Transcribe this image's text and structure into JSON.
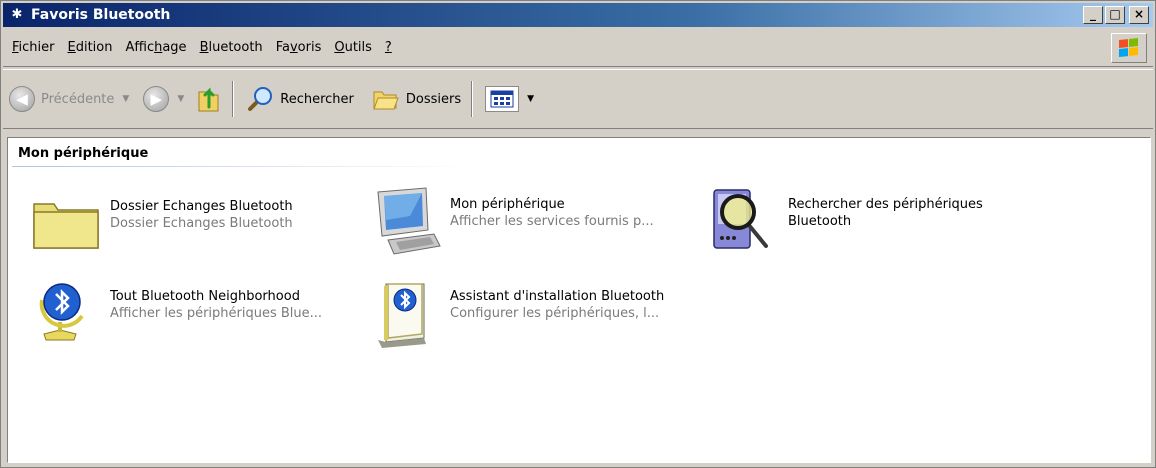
{
  "window": {
    "title": "Favoris Bluetooth",
    "buttons": {
      "minimize": "_",
      "maximize": "□",
      "close": "×"
    }
  },
  "menu": {
    "items": [
      {
        "first": "F",
        "rest": "ichier"
      },
      {
        "first": "E",
        "rest": "dition"
      },
      {
        "pre": "Affic",
        "first": "h",
        "rest": "age"
      },
      {
        "first": "B",
        "rest": "luetooth"
      },
      {
        "pre": "Fa",
        "first": "v",
        "rest": "oris"
      },
      {
        "first": "O",
        "rest": "utils"
      },
      {
        "first": "?",
        "rest": ""
      }
    ]
  },
  "toolbar": {
    "back_label": "Précédente",
    "search_label": "Rechercher",
    "folders_label": "Dossiers"
  },
  "content": {
    "section_title": "Mon périphérique",
    "items": [
      {
        "name": "Dossier Echanges Bluetooth",
        "desc": "Dossier Echanges Bluetooth",
        "icon": "folder-icon"
      },
      {
        "name": "Mon périphérique",
        "desc": "Afficher les services fournis p...",
        "icon": "computer-icon"
      },
      {
        "name": "Rechercher des périphériques",
        "name2": "Bluetooth",
        "desc": "",
        "icon": "device-search-icon"
      },
      {
        "name": "Tout Bluetooth Neighborhood",
        "desc": "Afficher les périphériques Blue...",
        "icon": "bluetooth-globe-icon"
      },
      {
        "name": "Assistant d'installation Bluetooth",
        "desc": "Configurer les périphériques, l...",
        "icon": "bluetooth-wizard-icon"
      }
    ]
  },
  "colors": {
    "title_gradient_start": "#0a246a",
    "title_gradient_end": "#a6caf0",
    "chrome": "#d4d0c8",
    "disabled_text": "#8a8a8a",
    "desc_text": "#7a7a7a",
    "bluetooth_blue": "#1f50c8"
  }
}
